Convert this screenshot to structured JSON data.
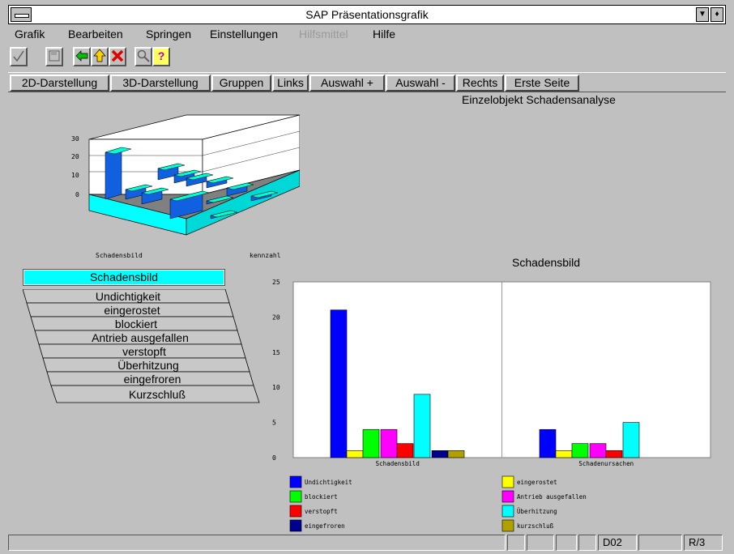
{
  "window": {
    "title": "SAP Präsentationsgrafik"
  },
  "menu": [
    {
      "label": "Grafik",
      "enabled": true
    },
    {
      "label": "Bearbeiten",
      "enabled": true
    },
    {
      "label": "Springen",
      "enabled": true
    },
    {
      "label": "Einstellungen",
      "enabled": true
    },
    {
      "label": "Hilfsmittel",
      "enabled": false
    },
    {
      "label": "Hilfe",
      "enabled": true
    }
  ],
  "toolbar": {
    "icons": [
      "check-icon",
      "save-icon",
      "back-arrow-icon",
      "up-arrow-icon",
      "cancel-icon",
      "find-icon",
      "help-icon"
    ]
  },
  "buttons": [
    "2D-Darstellung",
    "3D-Darstellung",
    "Gruppen",
    "Links",
    "Auswahl +",
    "Auswahl -",
    "Rechts",
    "Erste Seite"
  ],
  "main": {
    "title": "Einzelobjekt Schadensanalyse",
    "chart_title": "Schadensbild",
    "thumb": {
      "ticks": [
        "30",
        "20",
        "10",
        "0"
      ],
      "label_left": "Schadensbild",
      "label_right": "kennzahl"
    }
  },
  "legend3d": {
    "header": "Schadensbild",
    "items": [
      "Undichtigkeit",
      "eingerostet",
      "blockiert",
      "Antrieb ausgefallen",
      "verstopft",
      "Überhitzung",
      "eingefroren",
      "Kurzschluß"
    ]
  },
  "chart_data": {
    "type": "bar",
    "title": "Schadensbild",
    "categories": [
      "Schadensbild",
      "Schadenursachen"
    ],
    "ylim": [
      0,
      25
    ],
    "yticks": [
      "0",
      "5",
      "10",
      "15",
      "20",
      "25"
    ],
    "grid": true,
    "legend_position": "bottom",
    "series": [
      {
        "name": "Undichtigkeit",
        "color": "#0000ff",
        "values": [
          21,
          4
        ]
      },
      {
        "name": "eingerostet",
        "color": "#ffff00",
        "values": [
          1,
          1
        ]
      },
      {
        "name": "blockiert",
        "color": "#00ff00",
        "values": [
          4,
          2
        ]
      },
      {
        "name": "Antrieb ausgefallen",
        "color": "#ff00ff",
        "values": [
          4,
          2
        ]
      },
      {
        "name": "verstopft",
        "color": "#ff0000",
        "values": [
          2,
          1
        ]
      },
      {
        "name": "Überhitzung",
        "color": "#00ffff",
        "values": [
          9,
          5
        ]
      },
      {
        "name": "eingefroren",
        "color": "#000090",
        "values": [
          1,
          0
        ]
      },
      {
        "name": "kurzschluß",
        "color": "#b0a000",
        "values": [
          1,
          0
        ]
      }
    ]
  },
  "status": {
    "cells": [
      "",
      "",
      "",
      "",
      "",
      "D02",
      "",
      "R/3"
    ]
  }
}
